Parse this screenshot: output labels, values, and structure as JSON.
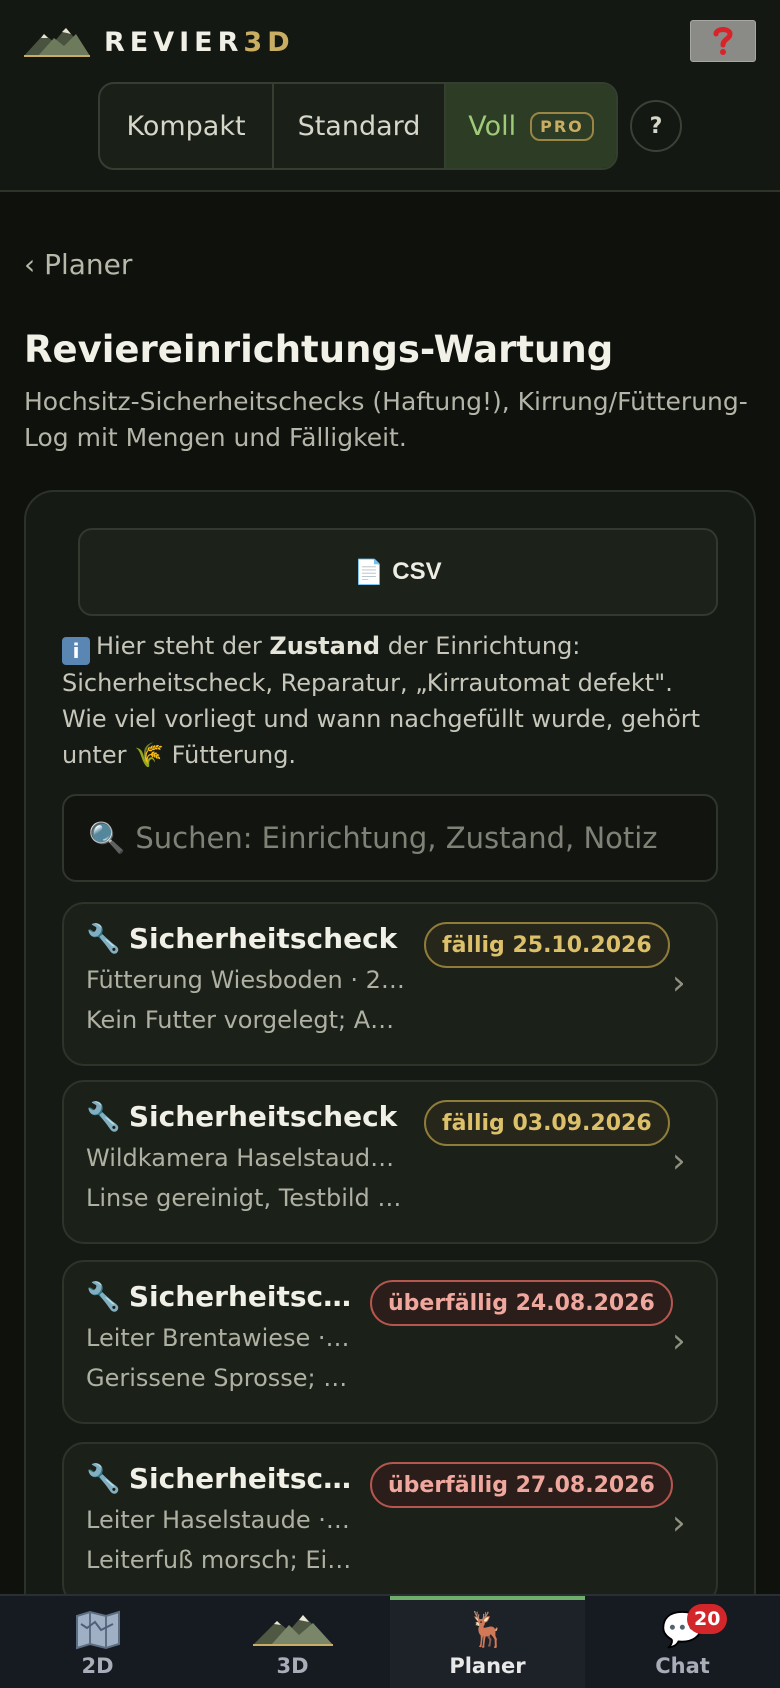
{
  "header": {
    "logo_text_main": "REVIER",
    "logo_text_accent": "3D",
    "help_icon": "question-mark-red-icon",
    "view_modes": [
      {
        "label": "Kompakt",
        "active": false
      },
      {
        "label": "Standard",
        "active": false
      },
      {
        "label": "Voll",
        "active": true,
        "badge": "PRO"
      }
    ],
    "info_button_label": "?"
  },
  "nav": {
    "back_label": "‹ Planer"
  },
  "page": {
    "title": "Reviereinrichtungs-Wartung",
    "subtitle": "Hochsitz-Sicherheitschecks (Haftung!), Kirrung/Fütterung-Log mit Mengen und Fälligkeit."
  },
  "toolbar": {
    "csv_icon": "document-icon",
    "csv_label": "CSV"
  },
  "info": {
    "part1": "Hier steht der ",
    "bold": "Zustand",
    "part2": " der Einrichtung: Sicherheitscheck, Reparatur, „Kirrautomat defekt\". Wie viel vorliegt und wann nachgefüllt wurde, gehört unter ",
    "link_icon": "wheat-icon",
    "part3": " Fütterung."
  },
  "search": {
    "placeholder": "Suchen: Einrichtung, Zustand, Notiz",
    "value": ""
  },
  "entries": [
    {
      "title": "Sicherheitscheck",
      "line1": "Fütterung Wiesboden · 2…",
      "line2": "Kein Futter vorgelegt; An…",
      "badge": "fällig 25.10.2026",
      "status": "due"
    },
    {
      "title": "Sicherheitscheck",
      "line1": "Wildkamera Haselstaude…",
      "line2": "Linse gereinigt, Testbild …",
      "badge": "fällig 03.09.2026",
      "status": "due"
    },
    {
      "title": "Sicherheitsche…",
      "line1": "Leiter Brentawiese · …",
      "line2": "Gerissene Sprosse; …",
      "badge": "überfällig 24.08.2026",
      "status": "over"
    },
    {
      "title": "Sicherheitsche…",
      "line1": "Leiter Haselstaude · …",
      "line2": "Leiterfuß morsch; Ei…",
      "badge": "überfällig 27.08.2026",
      "status": "over"
    }
  ],
  "bottom_nav": [
    {
      "label": "2D",
      "icon": "map-icon",
      "active": false
    },
    {
      "label": "3D",
      "icon": "mountain-icon",
      "active": false
    },
    {
      "label": "Planer",
      "icon": "deer-icon",
      "active": true
    },
    {
      "label": "Chat",
      "icon": "speech-bubble-icon",
      "active": false,
      "badge": "20"
    }
  ]
}
